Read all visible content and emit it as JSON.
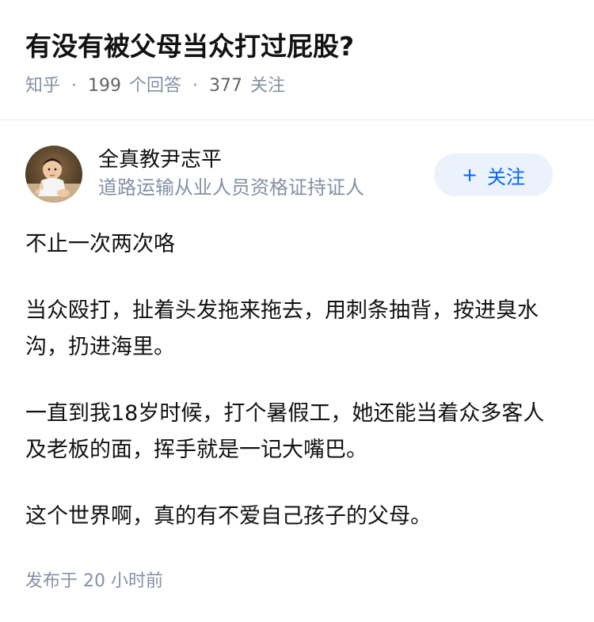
{
  "question": {
    "title": "有没有被父母当众打过屁股?",
    "site": "知乎",
    "separator": "·",
    "answer_count": "199",
    "answer_label": "个回答",
    "follower_count": "377",
    "follower_label": "关注"
  },
  "author": {
    "name": "全真教尹志平",
    "badge": "道路运输从业人员资格证持证人",
    "avatar_icon": "child-photo-avatar"
  },
  "follow_button": {
    "icon": "plus-icon",
    "plus": "+",
    "label": "关注"
  },
  "answer": {
    "paragraphs": [
      "不止一次两次咯",
      "当众殴打，扯着头发拖来拖去，用刺条抽背，按进臭水沟，扔进海里。",
      "一直到我18岁时候，打个暑假工，她还能当着众多客人及老板的面，挥手就是一记大嘴巴。",
      "这个世界啊，真的有不爱自己孩子的父母。"
    ],
    "published_label": "发布于",
    "published_time": "20 小时前"
  },
  "colors": {
    "title": "#121212",
    "meta": "#8590a6",
    "accent": "#0066ff",
    "follow_bg": "#ebf2fb",
    "divider": "#ebebeb"
  }
}
